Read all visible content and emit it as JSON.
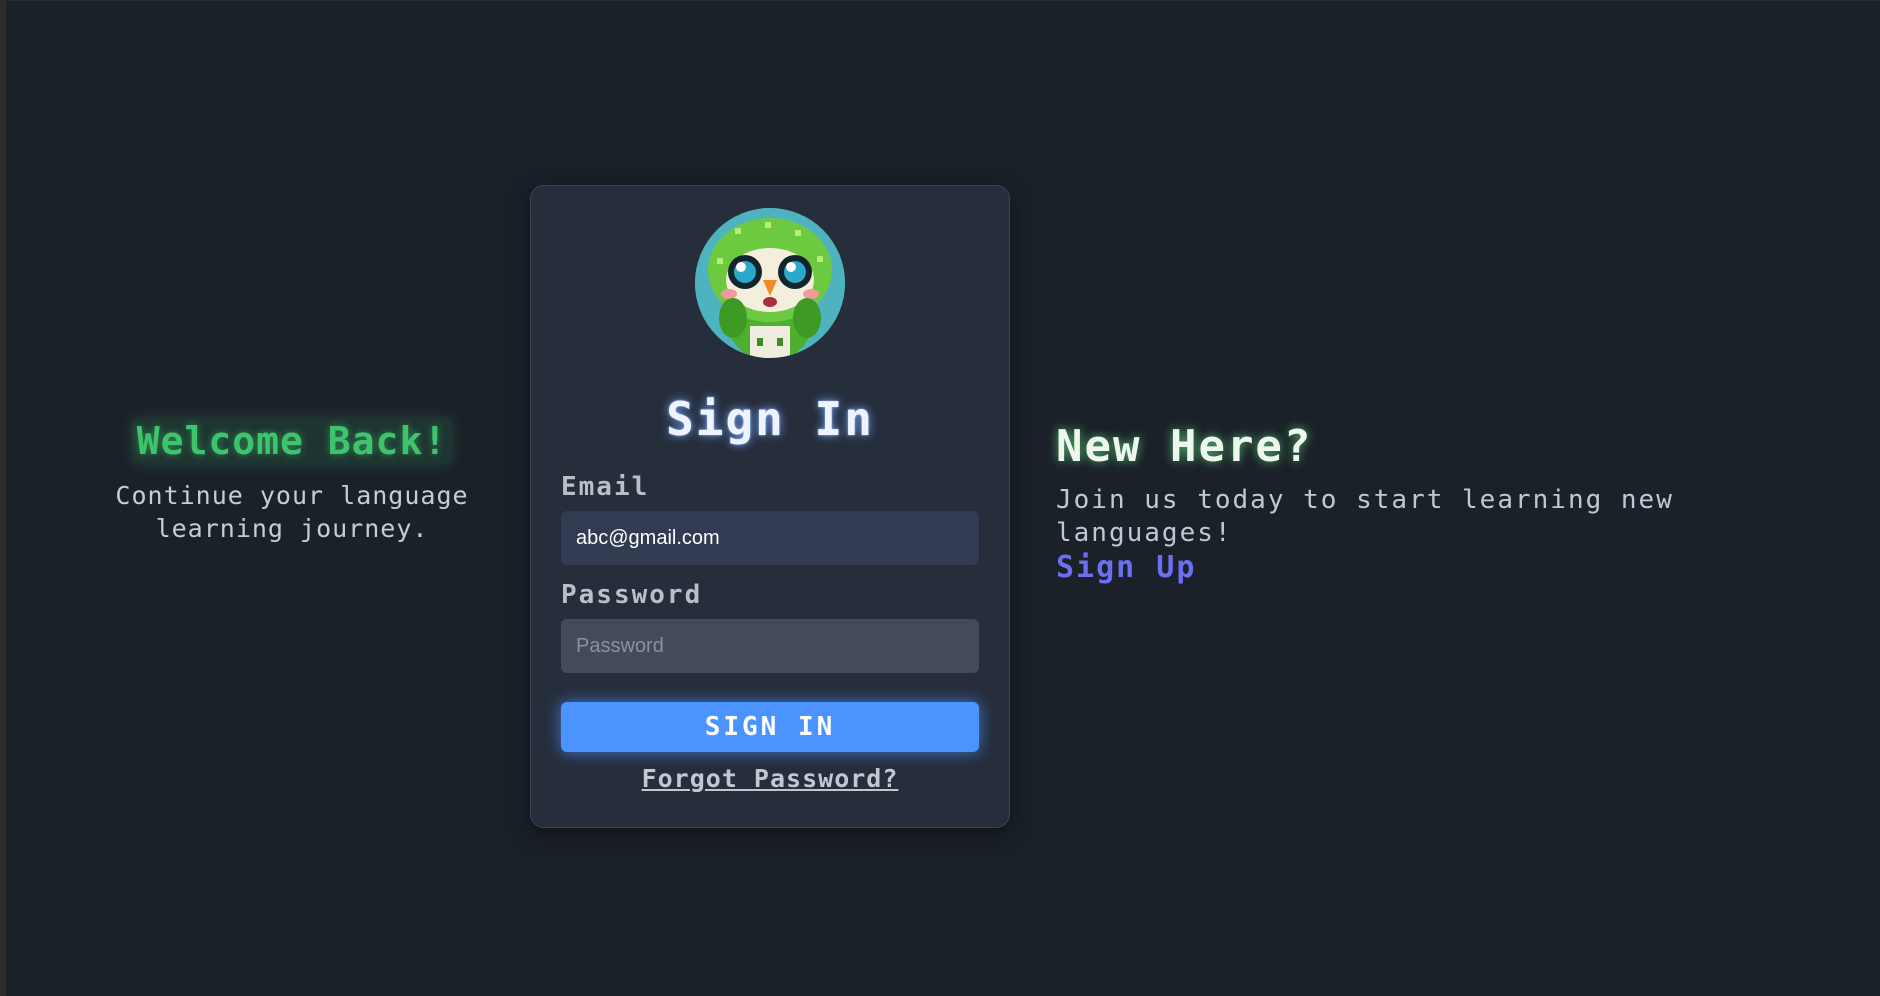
{
  "welcome": {
    "title": "Welcome Back!",
    "subtitle": "Continue your language learning journey."
  },
  "signin": {
    "title": "Sign In",
    "email_label": "Email",
    "email_value": "abc@gmail.com",
    "password_label": "Password",
    "password_placeholder": "Password",
    "button_label": "SIGN IN",
    "forgot_label": "Forgot Password?",
    "avatar_icon": "owl-mascot-icon"
  },
  "newhere": {
    "title": "New Here?",
    "text": "Join us today to start learning new languages!",
    "link": "Sign Up"
  },
  "colors": {
    "background": "#1b2129",
    "card": "#262d3b",
    "accent_green": "#3ec46d",
    "button_blue": "#4b93ff",
    "link_purple": "#6d6ff2"
  }
}
